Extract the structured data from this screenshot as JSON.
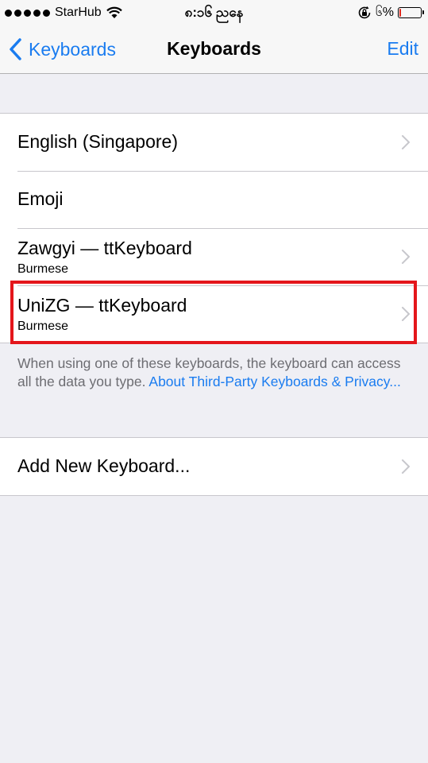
{
  "status": {
    "carrier": "StarHub",
    "time": "၈:၁၆ ညနေ",
    "battery_text": "၆%",
    "battery_level": 0.06,
    "battery_color": "#e0261a",
    "signal_icon": "signal-dots-icon",
    "wifi_icon": "wifi-icon",
    "rotation_lock_icon": "rotation-lock-icon"
  },
  "nav": {
    "back_label": "Keyboards",
    "title": "Keyboards",
    "edit_label": "Edit"
  },
  "keyboards": [
    {
      "title": "English (Singapore)",
      "subtitle": ""
    },
    {
      "title": "Emoji",
      "subtitle": ""
    },
    {
      "title": "Zawgyi — ttKeyboard",
      "subtitle": "Burmese"
    },
    {
      "title": "UniZG — ttKeyboard",
      "subtitle": "Burmese"
    }
  ],
  "footer": {
    "text": "When using one of these keyboards, the keyboard can access all the data you type. ",
    "link": "About Third-Party Keyboards & Privacy..."
  },
  "add_keyboard": {
    "label": "Add New Keyboard..."
  },
  "colors": {
    "accent": "#1a7cf0",
    "highlight": "#e4161b",
    "background": "#efeff4"
  }
}
